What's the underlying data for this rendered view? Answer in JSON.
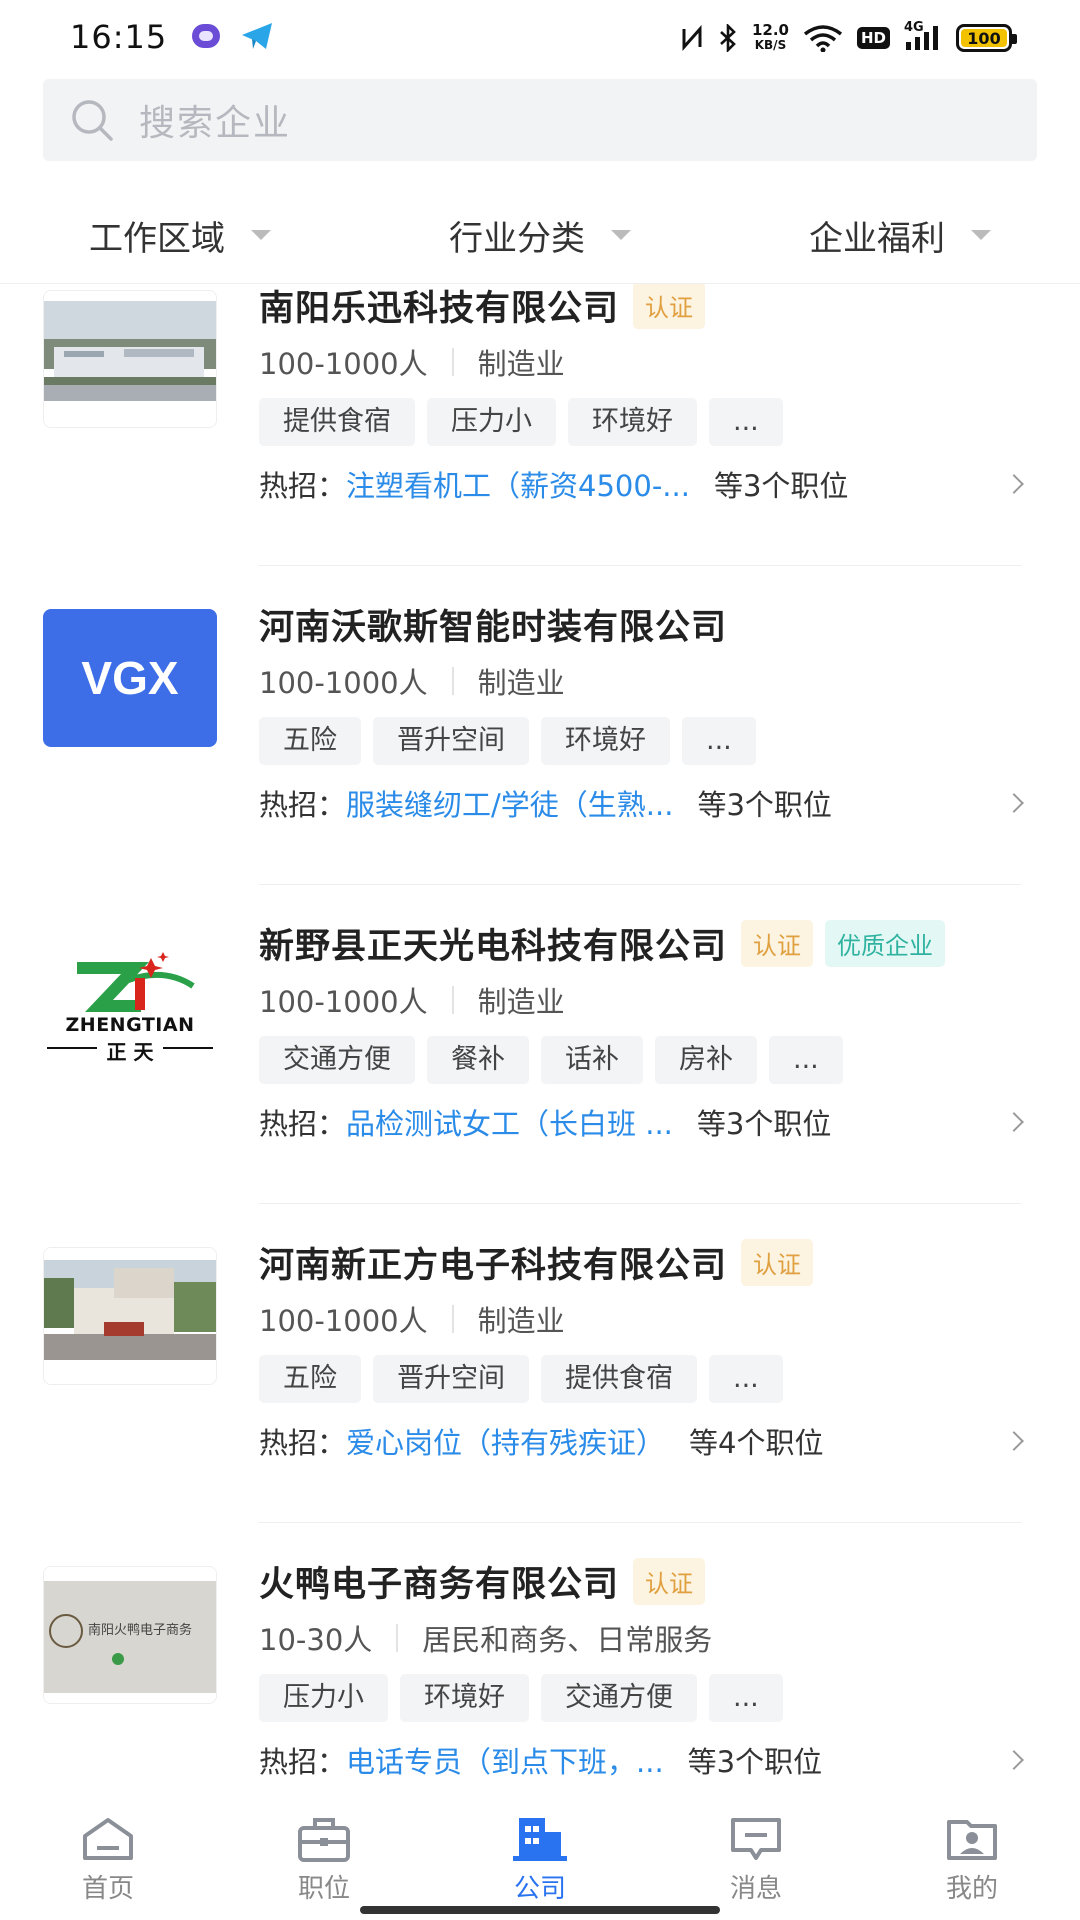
{
  "status_bar": {
    "time": "16:15",
    "net_speed_value": "12.0",
    "net_speed_unit": "KB/S",
    "hd": "HD",
    "signal": "4G",
    "battery": "100"
  },
  "search": {
    "placeholder": "搜索企业"
  },
  "filters": [
    {
      "label": "工作区域"
    },
    {
      "label": "行业分类"
    },
    {
      "label": "企业福利"
    }
  ],
  "companies": [
    {
      "name": "南阳乐迅科技有限公司",
      "badges": [
        "认证"
      ],
      "size": "100-1000人",
      "industry": "制造业",
      "tags": [
        "提供食宿",
        "压力小",
        "环境好",
        "..."
      ],
      "hot_label": "热招：",
      "hot_job": "注塑看机工（薪资4500-...",
      "job_count": "等3个职位"
    },
    {
      "name": "河南沃歌斯智能时装有限公司",
      "badges": [],
      "logo_text": "VGX",
      "size": "100-1000人",
      "industry": "制造业",
      "tags": [
        "五险",
        "晋升空间",
        "环境好",
        "..."
      ],
      "hot_label": "热招：",
      "hot_job": "服装缝纫工/学徒（生熟...",
      "job_count": "等3个职位"
    },
    {
      "name": "新野县正天光电科技有限公司",
      "badges": [
        "认证",
        "优质企业"
      ],
      "logo_text": "ZHENGTIAN",
      "logo_sub": "正 天",
      "size": "100-1000人",
      "industry": "制造业",
      "tags": [
        "交通方便",
        "餐补",
        "话补",
        "房补",
        "..."
      ],
      "hot_label": "热招：",
      "hot_job": "品检测试女工（长白班 ...",
      "job_count": "等3个职位"
    },
    {
      "name": "河南新正方电子科技有限公司",
      "badges": [
        "认证"
      ],
      "size": "100-1000人",
      "industry": "制造业",
      "tags": [
        "五险",
        "晋升空间",
        "提供食宿",
        "..."
      ],
      "hot_label": "热招：",
      "hot_job": "爱心岗位（持有残疾证）",
      "job_count": "等4个职位"
    },
    {
      "name": "火鸭电子商务有限公司",
      "badges": [
        "认证"
      ],
      "logo_text": "南阳火鸭电子商务",
      "size": "10-30人",
      "industry": "居民和商务、日常服务",
      "tags": [
        "压力小",
        "环境好",
        "交通方便",
        "..."
      ],
      "hot_label": "热招：",
      "hot_job": "电话专员（到点下班，...",
      "job_count": "等3个职位"
    }
  ],
  "tabbar": [
    {
      "label": "首页",
      "icon": "home-icon"
    },
    {
      "label": "职位",
      "icon": "briefcase-icon"
    },
    {
      "label": "公司",
      "icon": "building-icon",
      "active": true
    },
    {
      "label": "消息",
      "icon": "message-icon"
    },
    {
      "label": "我的",
      "icon": "profile-icon"
    }
  ],
  "colors": {
    "accent": "#2a73f0",
    "link": "#2a8be8",
    "cert": "#e0a040",
    "quality": "#2fb3a0"
  }
}
